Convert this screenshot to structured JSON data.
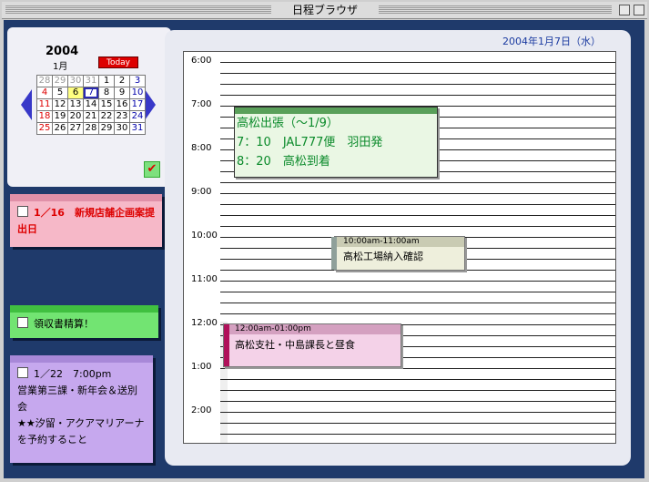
{
  "window": {
    "title": "日程ブラウザ"
  },
  "calendar": {
    "year": "2004",
    "month": "1月",
    "today_label": "Today",
    "weeks": [
      [
        "28",
        "29",
        "30",
        "31",
        "1",
        "2",
        "3"
      ],
      [
        "4",
        "5",
        "6",
        "7",
        "8",
        "9",
        "10"
      ],
      [
        "11",
        "12",
        "13",
        "14",
        "15",
        "16",
        "17"
      ],
      [
        "18",
        "19",
        "20",
        "21",
        "22",
        "23",
        "24"
      ],
      [
        "25",
        "26",
        "27",
        "28",
        "29",
        "30",
        "31"
      ]
    ]
  },
  "notes": [
    {
      "text": "1／16　新規店舗企画案提出日",
      "color": "#f6b8c8",
      "bar": "#e090a8"
    },
    {
      "text": "領収書精算！",
      "color": "#72e472",
      "bar": "#40c040"
    },
    {
      "text": "1／22　7:00pm\n営業第三課・新年会＆送別会\n★★汐留・アクアマリアーナを予約すること",
      "color": "#c6a8ee",
      "bar": "#a888d8"
    }
  ],
  "schedule": {
    "date": "2004年1月7日（水）",
    "hours": [
      "6:00",
      "7:00",
      "8:00",
      "9:00",
      "10:00",
      "11:00",
      "12:00",
      "1:00",
      "2:00"
    ],
    "events": [
      {
        "lines": [
          "高松出張（～1/9）",
          "7：10　JAL777便　羽田発",
          "8：20　高松到着"
        ]
      },
      {
        "time": "10:00am-11:00am",
        "text": "高松工場納入確認"
      },
      {
        "time": "12:00am-01:00pm",
        "text": "高松支社・中島課長と昼食"
      }
    ]
  }
}
